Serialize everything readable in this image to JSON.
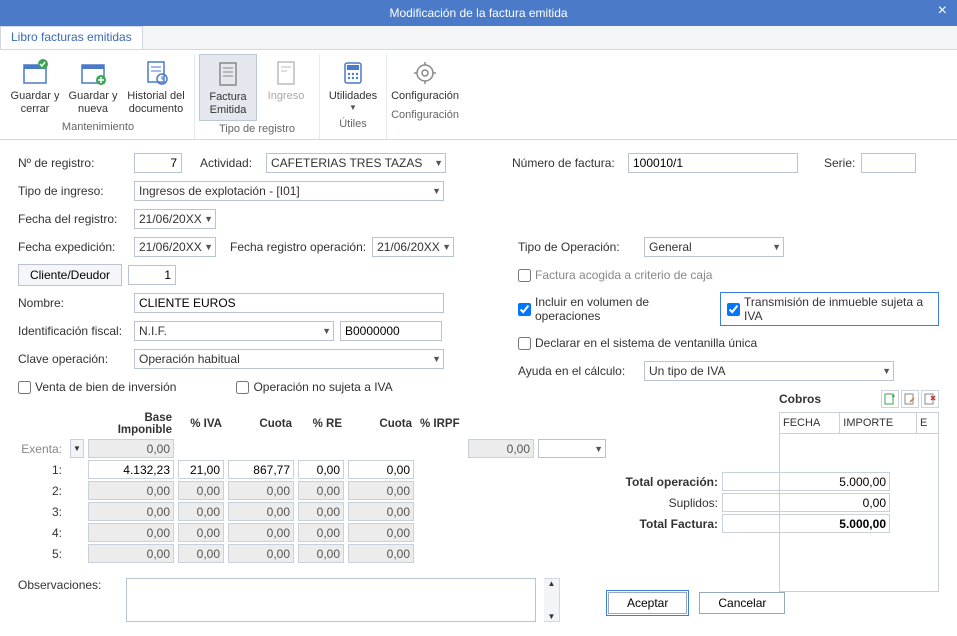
{
  "window": {
    "title": "Modificación de la factura emitida"
  },
  "tab": {
    "label": "Libro facturas emitidas"
  },
  "ribbon": {
    "groups": [
      {
        "label": "Mantenimiento",
        "items": [
          {
            "label": "Guardar y cerrar",
            "icon": "save-close"
          },
          {
            "label": "Guardar y nueva",
            "icon": "save-new"
          },
          {
            "label": "Historial del documento",
            "icon": "history"
          }
        ]
      },
      {
        "label": "Tipo de registro",
        "items": [
          {
            "label": "Factura Emitida",
            "icon": "invoice",
            "selected": true
          },
          {
            "label": "Ingreso",
            "icon": "income"
          }
        ]
      },
      {
        "label": "Útiles",
        "items": [
          {
            "label": "Utilidades",
            "icon": "utilities"
          }
        ]
      },
      {
        "label": "Configuración",
        "items": [
          {
            "label": "Configuración",
            "icon": "settings"
          }
        ]
      }
    ]
  },
  "form": {
    "n_registro_lbl": "Nº de registro:",
    "n_registro": "7",
    "actividad_lbl": "Actividad:",
    "actividad": "CAFETERIAS TRES TAZAS",
    "num_factura_lbl": "Número de factura:",
    "num_factura": "100010/1",
    "serie_lbl": "Serie:",
    "serie": "",
    "tipo_ingreso_lbl": "Tipo de ingreso:",
    "tipo_ingreso": "Ingresos de explotación - [I01]",
    "fecha_registro_lbl": "Fecha del registro:",
    "fecha_registro": "21/06/20XX",
    "fecha_exp_lbl": "Fecha expedición:",
    "fecha_exp": "21/06/20XX",
    "fecha_reg_op_lbl": "Fecha registro operación:",
    "fecha_reg_op": "21/06/20XX",
    "tipo_op_lbl": "Tipo de Operación:",
    "tipo_op": "General",
    "cliente_btn": "Cliente/Deudor",
    "cliente_num": "1",
    "factura_caja_lbl": "Factura acogida a criterio de caja",
    "nombre_lbl": "Nombre:",
    "nombre": "CLIENTE EUROS",
    "incluir_vol_lbl": "Incluir en  volumen de operaciones",
    "transmision_lbl": "Transmisión de inmueble sujeta a IVA",
    "id_fiscal_lbl": "Identificación fiscal:",
    "id_fiscal_tipo": "N.I.F.",
    "id_fiscal_num": "B0000000",
    "declarar_vu_lbl": "Declarar en el sistema de ventanilla única",
    "clave_op_lbl": "Clave operación:",
    "clave_op": "Operación habitual",
    "ayuda_calc_lbl": "Ayuda en el cálculo:",
    "ayuda_calc": "Un tipo de IVA",
    "venta_bien_lbl": "Venta de bien de inversión",
    "op_no_sujeta_lbl": "Operación no sujeta a IVA"
  },
  "lines": {
    "headers": {
      "base": "Base Imponible",
      "iva": "% IVA",
      "cuota": "Cuota",
      "re": "% RE",
      "cuota2": "Cuota",
      "irpf": "% IRPF"
    },
    "exenta_lbl": "Exenta:",
    "rows_lbl": [
      "1:",
      "2:",
      "3:",
      "4:",
      "5:"
    ],
    "exenta": {
      "base": "0,00",
      "irpf_cuota": "0,00",
      "extra": "0,00"
    },
    "rows": [
      {
        "base": "4.132,23",
        "iva": "21,00",
        "cuota": "867,77",
        "re": "0,00",
        "cuota2": "0,00"
      },
      {
        "base": "0,00",
        "iva": "0,00",
        "cuota": "0,00",
        "re": "0,00",
        "cuota2": "0,00"
      },
      {
        "base": "0,00",
        "iva": "0,00",
        "cuota": "0,00",
        "re": "0,00",
        "cuota2": "0,00"
      },
      {
        "base": "0,00",
        "iva": "0,00",
        "cuota": "0,00",
        "re": "0,00",
        "cuota2": "0,00"
      },
      {
        "base": "0,00",
        "iva": "0,00",
        "cuota": "0,00",
        "re": "0,00",
        "cuota2": "0,00"
      }
    ]
  },
  "totals": {
    "total_op_lbl": "Total operación:",
    "total_op": "5.000,00",
    "suplidos_lbl": "Suplidos:",
    "suplidos": "0,00",
    "total_fac_lbl": "Total Factura:",
    "total_fac": "5.000,00"
  },
  "cobros": {
    "title": "Cobros",
    "cols": {
      "fecha": "FECHA",
      "importe": "IMPORTE",
      "e": "E"
    }
  },
  "obs_lbl": "Observaciones:",
  "obs": "",
  "buttons": {
    "accept": "Aceptar",
    "cancel": "Cancelar"
  }
}
